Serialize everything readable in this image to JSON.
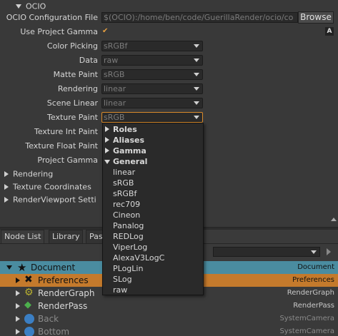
{
  "properties": {
    "section_ocio": "OCIO",
    "config_file_label": "OCIO Configuration File",
    "config_file_value": "$(OCIO):/home/ben/code/GuerillaRender/ocio/co",
    "browse_label": "Browse",
    "use_gamma_label": "Use Project Gamma",
    "use_gamma_checked": "✔",
    "auto_badge": "A",
    "fields": [
      {
        "label": "Color Picking",
        "value": "sRGBf"
      },
      {
        "label": "Data",
        "value": "raw"
      },
      {
        "label": "Matte Paint",
        "value": "sRGB"
      },
      {
        "label": "Rendering",
        "value": "linear"
      },
      {
        "label": "Scene Linear",
        "value": "linear"
      },
      {
        "label": "Texture Paint",
        "value": "sRGB"
      },
      {
        "label": "Texture Int Paint",
        "value": ""
      },
      {
        "label": "Texture Float Paint",
        "value": ""
      },
      {
        "label": "Project Gamma",
        "value": ""
      }
    ],
    "sections": [
      "Rendering",
      "Texture Coordinates",
      "RenderViewport Setti"
    ]
  },
  "dropdown": {
    "groups": [
      {
        "label": "Roles",
        "expanded": false
      },
      {
        "label": "Aliases",
        "expanded": false
      },
      {
        "label": "Gamma",
        "expanded": false
      },
      {
        "label": "General",
        "expanded": true
      }
    ],
    "items": [
      "linear",
      "sRGB",
      "sRGBf",
      "rec709",
      "Cineon",
      "Panalog",
      "REDLog",
      "ViperLog",
      "AlexaV3LogC",
      "PLogLin",
      "SLog",
      "raw"
    ]
  },
  "bottom": {
    "tabs": [
      "Node List",
      "Library",
      "Pas"
    ],
    "tree": [
      {
        "name": "Document",
        "type": "Document",
        "icon": "star-icon"
      },
      {
        "name": "Preferences",
        "type": "Preferences",
        "icon": "tools-icon"
      },
      {
        "name": "RenderGraph",
        "type": "RenderGraph",
        "icon": "gear-icon"
      },
      {
        "name": "RenderPass",
        "type": "RenderPass",
        "icon": "diamond-icon"
      },
      {
        "name": "Back",
        "type": "SystemCamera",
        "icon": "camera-icon"
      },
      {
        "name": "Bottom",
        "type": "SystemCamera",
        "icon": "camera-icon"
      }
    ]
  },
  "colors": {
    "accent": "#d98a2b",
    "document_row": "#4a8ca0",
    "preferences_row": "#c47a2c"
  }
}
